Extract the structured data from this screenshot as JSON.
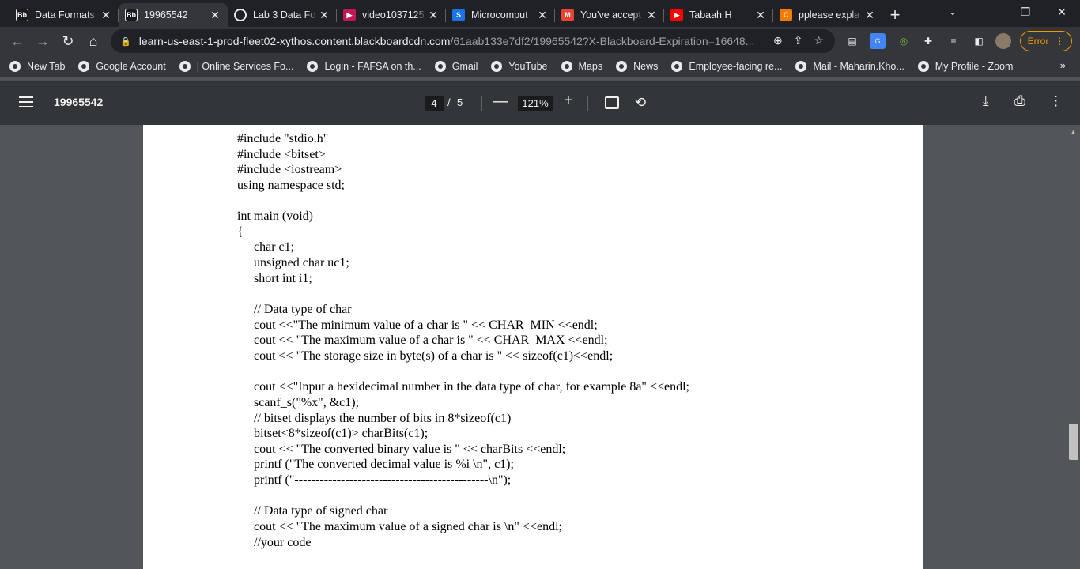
{
  "browser": {
    "tabs": [
      {
        "favicon_text": "Bb",
        "favicon_color": "#1a1a1a",
        "title": "Data Formats",
        "active": false
      },
      {
        "favicon_text": "Bb",
        "favicon_color": "#1a1a1a",
        "title": "19965542",
        "active": true
      },
      {
        "favicon_text": "",
        "favicon_color": "#e8eaed",
        "title": "Lab 3 Data Fo",
        "active": false
      },
      {
        "favicon_text": "▶",
        "favicon_color": "#c2185b",
        "title": "video1037125",
        "active": false
      },
      {
        "favicon_text": "S",
        "favicon_color": "#1a73e8",
        "title": "Microcomput",
        "active": false
      },
      {
        "favicon_text": "M",
        "favicon_color": "#ea4335",
        "title": "You've accept",
        "active": false
      },
      {
        "favicon_text": "▶",
        "favicon_color": "#ff0000",
        "title": "Tabaah H",
        "active": false
      },
      {
        "favicon_text": "C",
        "favicon_color": "#f57c00",
        "title": "pplease expla",
        "active": false
      }
    ],
    "url_host": "learn-us-east-1-prod-fleet02-xythos.content.blackboardcdn.com",
    "url_path": "/61aab133e7df2/19965542?X-Blackboard-Expiration=16648...",
    "error_label": "Error",
    "bookmarks": [
      "New Tab",
      "Google Account",
      "| Online Services Fo...",
      "Login - FAFSA on th...",
      "Gmail",
      "YouTube",
      "Maps",
      "News",
      "Employee-facing re...",
      "Mail - Maharin.Kho...",
      "My Profile - Zoom"
    ],
    "bookmarks_more": "»"
  },
  "pdf": {
    "title": "19965542",
    "current_page": "4",
    "separator": "/",
    "total_pages": "5",
    "zoom": "121%"
  },
  "document": {
    "lines": [
      {
        "text": "#include \"stdio.h\"",
        "indent": false
      },
      {
        "text": "#include <bitset>",
        "indent": false
      },
      {
        "text": "#include <iostream>",
        "indent": false
      },
      {
        "text": "using namespace std;",
        "indent": false
      },
      {
        "text": "",
        "indent": false
      },
      {
        "text": "int main (void)",
        "indent": false
      },
      {
        "text": "{",
        "indent": false
      },
      {
        "text": "char c1;",
        "indent": true
      },
      {
        "text": "unsigned char uc1;",
        "indent": true
      },
      {
        "text": "short int i1;",
        "indent": true
      },
      {
        "text": "",
        "indent": true
      },
      {
        "text": "// Data type of char",
        "indent": true
      },
      {
        "text": "cout <<\"The minimum value of a char is \" << CHAR_MIN <<endl;",
        "indent": true
      },
      {
        "text": "cout << \"The maximum value of a char is \" << CHAR_MAX <<endl;",
        "indent": true
      },
      {
        "text": "cout << \"The storage size in byte(s) of a char is \" << sizeof(c1)<<endl;",
        "indent": true
      },
      {
        "text": "",
        "indent": true
      },
      {
        "text": "cout <<\"Input a hexidecimal number in the data type of char, for example 8a\" <<endl;",
        "indent": true
      },
      {
        "text": "scanf_s(\"%x\", &c1);",
        "indent": true
      },
      {
        "text": "// bitset displays the number of bits in 8*sizeof(c1)",
        "indent": true
      },
      {
        "text": "bitset<8*sizeof(c1)> charBits(c1);",
        "indent": true
      },
      {
        "text": "cout << \"The converted binary value is \" << charBits <<endl;",
        "indent": true
      },
      {
        "text": "printf (\"The converted decimal value is %i \\n\", c1);",
        "indent": true
      },
      {
        "text": "printf (\"----------------------------------------------\\n\");",
        "indent": true
      },
      {
        "text": "",
        "indent": true
      },
      {
        "text": "// Data type of signed char",
        "indent": true
      },
      {
        "text": "cout << \"The maximum value of a signed char is \\n\" <<endl;",
        "indent": true
      },
      {
        "text": "//your code",
        "indent": true
      }
    ]
  },
  "colors": {
    "error": "#f29900",
    "pdf_toolbar": "#323639",
    "viewer_bg": "#525659"
  }
}
